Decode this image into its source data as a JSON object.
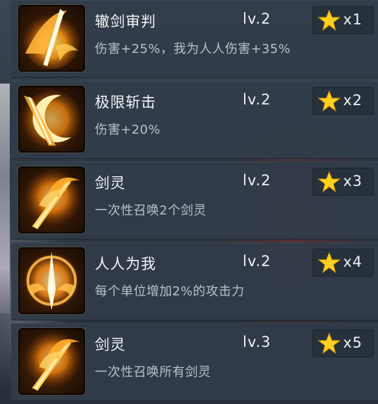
{
  "skills": [
    {
      "name": "辙剑审判",
      "level": "lv.2",
      "description": "伤害+25%，我为人人伤害+35%",
      "cost_count": "x1",
      "icon": "flame-spear-icon"
    },
    {
      "name": "极限斩击",
      "level": "lv.2",
      "description": "伤害+20%",
      "cost_count": "x2",
      "icon": "crescent-slash-icon"
    },
    {
      "name": "剑灵",
      "level": "lv.2",
      "description": "一次性召唤2个剑灵",
      "cost_count": "x3",
      "icon": "sword-spirit-icon"
    },
    {
      "name": "人人为我",
      "level": "lv.2",
      "description": "每个单位增加2%的攻击力",
      "cost_count": "x4",
      "icon": "radiant-blade-icon"
    },
    {
      "name": "剑灵",
      "level": "lv.3",
      "description": "一次性召唤所有剑灵",
      "cost_count": "x5",
      "icon": "sword-spirit-icon"
    }
  ],
  "colors": {
    "card_bg": "#303c48",
    "badge_bg": "#26313c",
    "star": "#ffd21f",
    "text_primary": "#f4f6f8",
    "text_secondary": "#b7c2cc",
    "flame": "#ff9d1a"
  }
}
